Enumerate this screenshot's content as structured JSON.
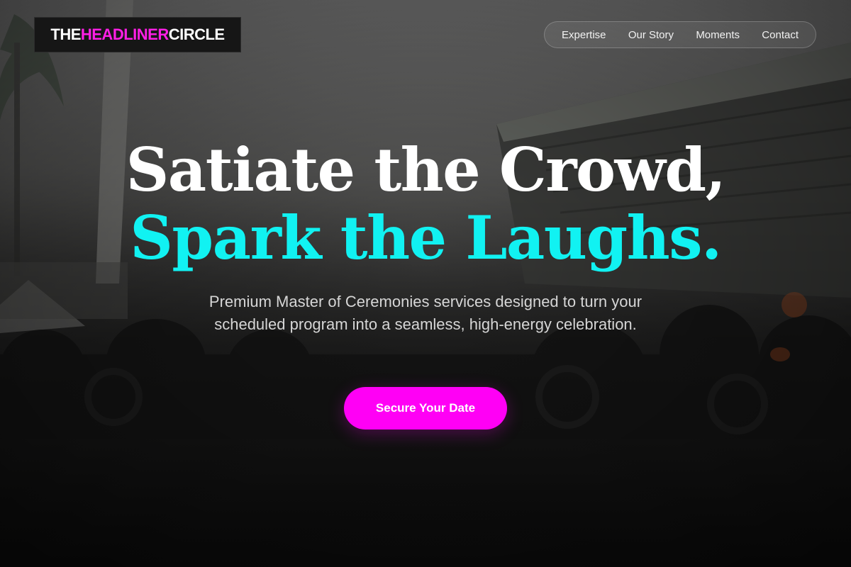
{
  "logo": {
    "word1": "THE ",
    "word2": "HEADLINER",
    "word3": " CIRCLE"
  },
  "nav": {
    "items": [
      {
        "label": "Expertise"
      },
      {
        "label": "Our Story"
      },
      {
        "label": "Moments"
      },
      {
        "label": "Contact"
      }
    ]
  },
  "hero": {
    "headline_line1": "Satiate the Crowd,",
    "headline_line2": "Spark the Laughs.",
    "subtitle": "Premium Master of Ceremonies services designed to turn your scheduled program into a seamless, high-energy celebration.",
    "cta_label": "Secure Your Date"
  },
  "colors": {
    "accent_pink": "#ff00f5",
    "accent_cyan": "#11f2f2",
    "logo_bg": "#161616"
  }
}
